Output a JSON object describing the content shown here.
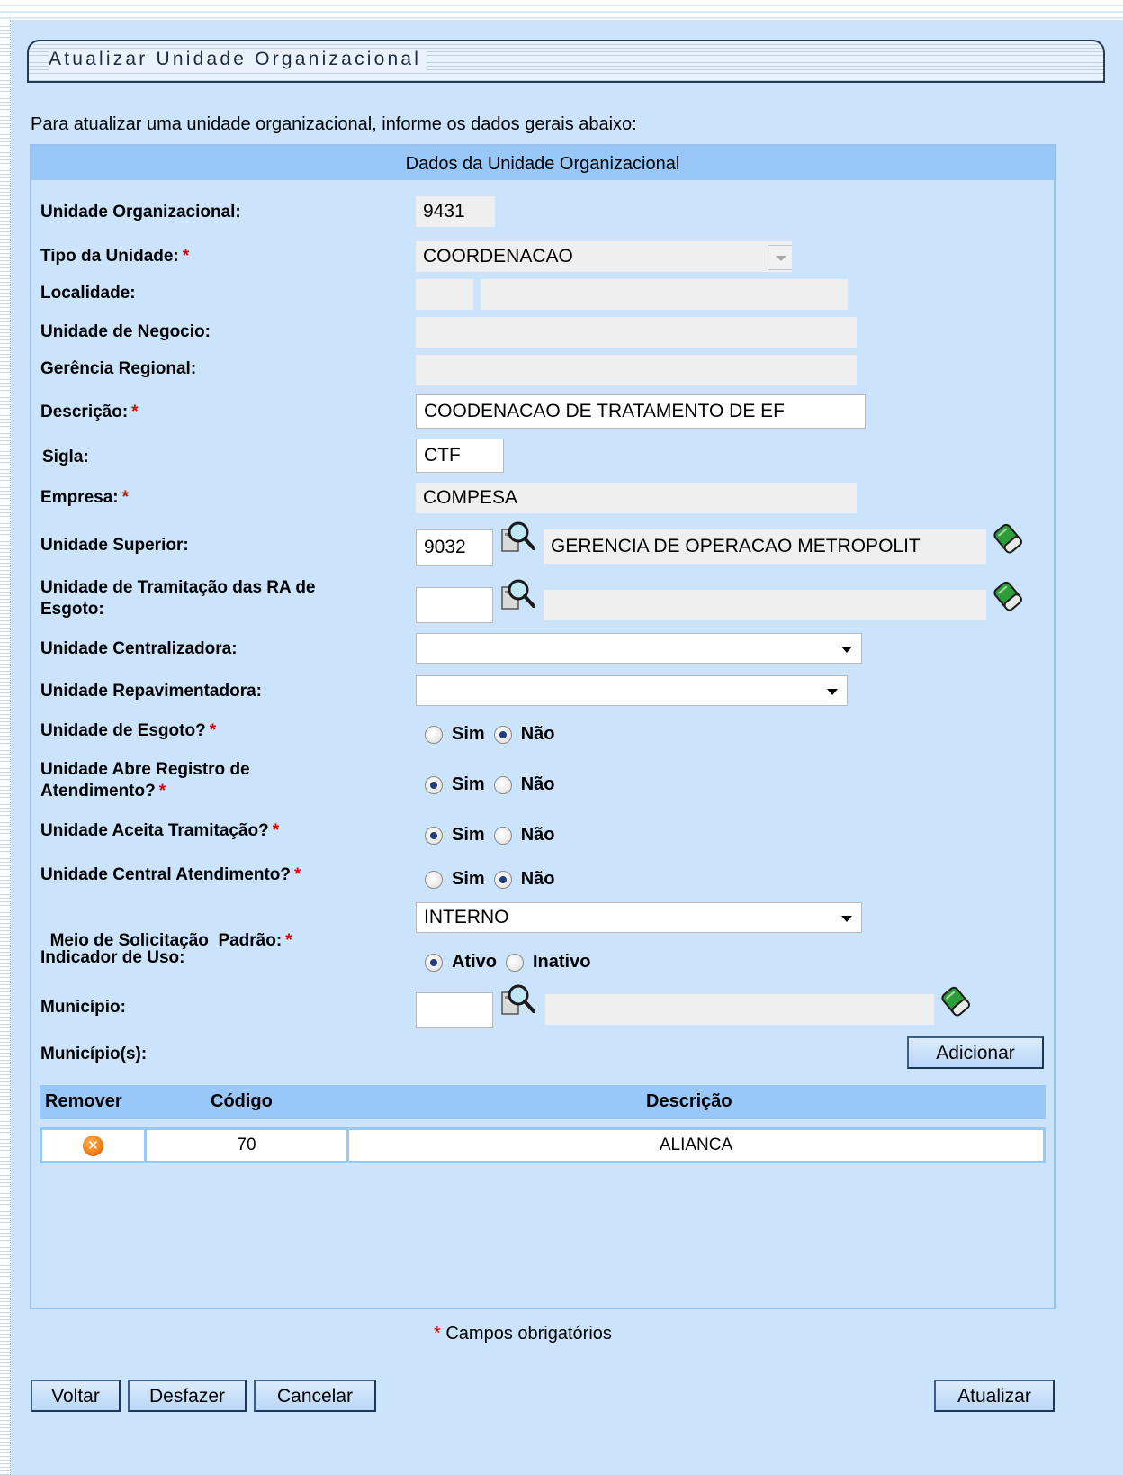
{
  "page": {
    "title": "Atualizar Unidade Organizacional",
    "intro": "Para atualizar uma unidade organizacional, informe os dados gerais abaixo:",
    "section_title": "Dados da Unidade Organizacional"
  },
  "fields": {
    "unidade_organizacional": {
      "label": "Unidade Organizacional:",
      "value": "9431"
    },
    "tipo_unidade": {
      "label": "Tipo da Unidade:",
      "value": "COORDENACAO"
    },
    "localidade": {
      "label": "Localidade:",
      "code": "",
      "name": ""
    },
    "unidade_negocio": {
      "label": "Unidade de Negocio:",
      "value": ""
    },
    "gerencia_regional": {
      "label": "Gerência Regional:",
      "value": ""
    },
    "descricao": {
      "label": "Descrição:",
      "value": "COODENACAO DE TRATAMENTO DE EF"
    },
    "sigla": {
      "label": "Sigla:",
      "value": "CTF"
    },
    "empresa": {
      "label": "Empresa:",
      "value": "COMPESA"
    },
    "unidade_superior": {
      "label": "Unidade Superior:",
      "code": "9032",
      "name": "GERENCIA DE OPERACAO METROPOLIT"
    },
    "unidade_tramitacao": {
      "label_line1": "Unidade de Tramitação das RA de",
      "label_line2": "Esgoto:",
      "code": "",
      "name": ""
    },
    "unidade_centralizadora": {
      "label": "Unidade Centralizadora:",
      "value": ""
    },
    "unidade_repavimentadora": {
      "label": "Unidade Repavimentadora:",
      "value": ""
    },
    "unidade_esgoto": {
      "label": "Unidade de Esgoto?",
      "selected": "Não"
    },
    "unidade_abre_registro": {
      "label_line1": "Unidade Abre Registro de",
      "label_line2": "Atendimento?",
      "selected": "Sim"
    },
    "unidade_aceita_tramitacao": {
      "label": "Unidade Aceita Tramitação?",
      "selected": "Sim"
    },
    "unidade_central_atendimento": {
      "label": "Unidade Central Atendimento?",
      "selected": "Não"
    },
    "meio_solicitacao": {
      "label": "Meio de Solicitação  Padrão:",
      "value": "INTERNO"
    },
    "indicador_uso": {
      "label": "Indicador de Uso:",
      "selected": "Ativo"
    },
    "municipio": {
      "label": "Município:",
      "code": "",
      "name": ""
    },
    "municipios": {
      "label": "Município(s):"
    }
  },
  "options": {
    "sim": "Sim",
    "nao": "Não",
    "ativo": "Ativo",
    "inativo": "Inativo"
  },
  "required_marker": "*",
  "table": {
    "headers": {
      "remover": "Remover",
      "codigo": "Código",
      "descricao": "Descrição"
    },
    "rows": [
      {
        "codigo": "70",
        "descricao": "ALIANCA"
      }
    ]
  },
  "buttons": {
    "adicionar": "Adicionar",
    "voltar": "Voltar",
    "desfazer": "Desfazer",
    "cancelar": "Cancelar",
    "atualizar": "Atualizar"
  },
  "footer": {
    "required_note": "Campos obrigatórios"
  },
  "icons": {
    "lookup": "magnifier-lookup-icon",
    "clear": "eraser-icon",
    "remove": "remove-x-icon"
  },
  "colors": {
    "panel_bg": "#cbe3fb",
    "header_bg": "#99c8f8",
    "required": "#e00000"
  }
}
